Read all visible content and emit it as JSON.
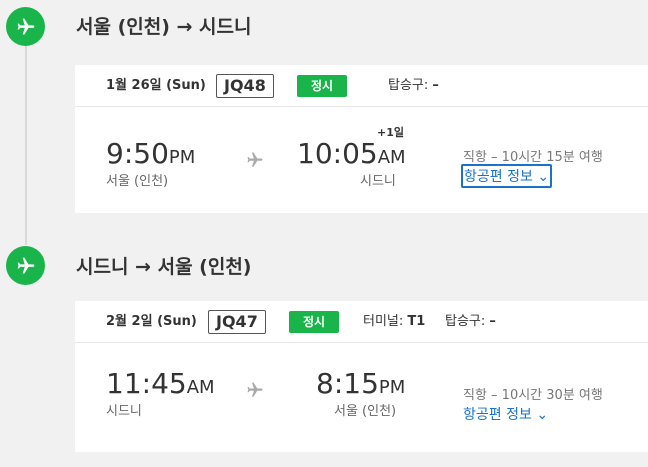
{
  "colors": {
    "accent_green": "#1ab54a",
    "link_blue": "#1a73c8",
    "background": "#f1f1f1"
  },
  "icons": {
    "leg_marker": "airplane-icon",
    "between_times": "airplane-icon",
    "link_chevron": "chevron-down-icon"
  },
  "legs": [
    {
      "route": "서울 (인천) → 시드니",
      "date": "1월 26일 (Sun)",
      "flight_number": "JQ48",
      "status": "정시",
      "terminal_label": "",
      "terminal_value": "",
      "gate_label": "탑승구:",
      "gate_value": "–",
      "departure_time": "9:50",
      "departure_ampm": "PM",
      "departure_city": "서울 (인천)",
      "arrival_day_offset": "+1일",
      "arrival_time": "10:05",
      "arrival_ampm": "AM",
      "arrival_city": "시드니",
      "duration": "직항 – 10시간 15분 여행",
      "details_link": "항공편 정보",
      "details_chevron": "⌄"
    },
    {
      "route": "시드니 → 서울 (인천)",
      "date": "2월 2일 (Sun)",
      "flight_number": "JQ47",
      "status": "정시",
      "terminal_label": "터미널:",
      "terminal_value": "T1",
      "gate_label": "탑승구:",
      "gate_value": "–",
      "departure_time": "11:45",
      "departure_ampm": "AM",
      "departure_city": "시드니",
      "arrival_day_offset": "",
      "arrival_time": "8:15",
      "arrival_ampm": "PM",
      "arrival_city": "서울 (인천)",
      "duration": "직항 – 10시간 30분 여행",
      "details_link": "항공편 정보",
      "details_chevron": "⌄"
    }
  ]
}
